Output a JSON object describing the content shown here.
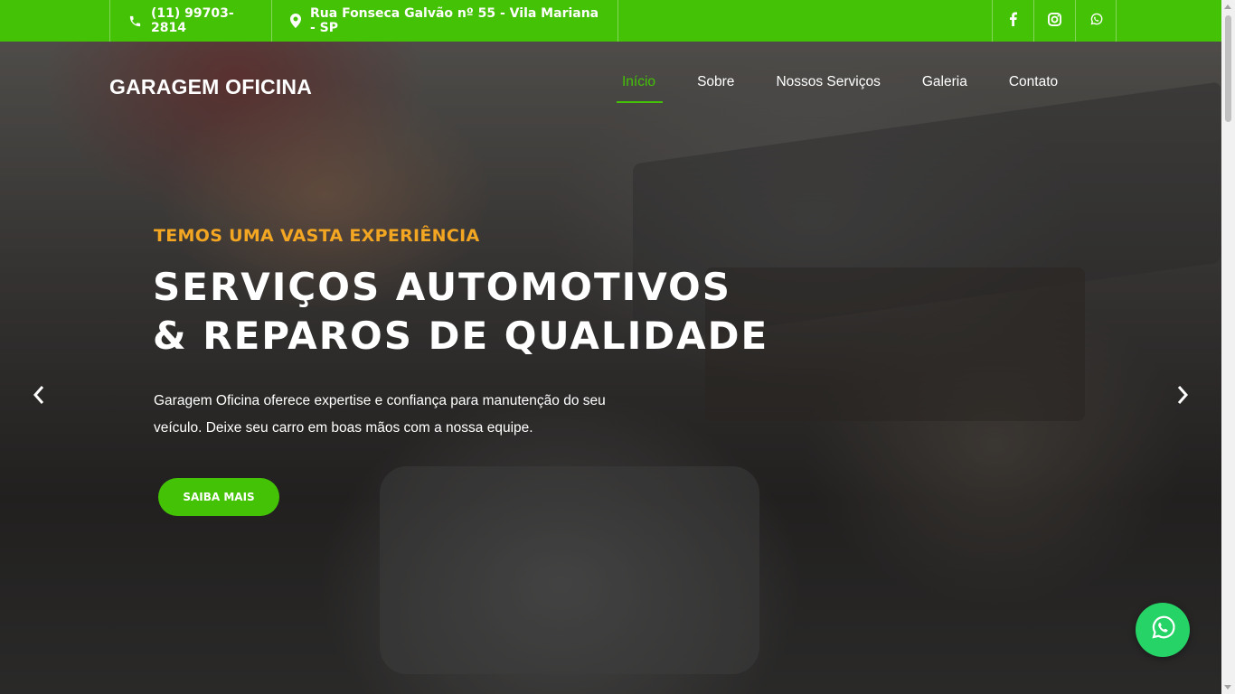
{
  "topbar": {
    "phone": "(11) 99703-2814",
    "address": "Rua Fonseca Galvão nº 55 - Vila Mariana - SP",
    "social": [
      "facebook-icon",
      "instagram-icon",
      "whatsapp-icon"
    ]
  },
  "header": {
    "brand": "GARAGEM OFICINA",
    "nav": [
      "Início",
      "Sobre",
      "Nossos Serviços",
      "Galeria",
      "Contato"
    ],
    "active_nav": "Início"
  },
  "hero": {
    "kicker": "TEMOS UMA VASTA EXPERIÊNCIA",
    "headline_line1": "SERVIÇOS AUTOMOTIVOS",
    "headline_line2": "& REPAROS DE QUALIDADE",
    "description_line1": "Garagem Oficina oferece expertise e confiança para manutenção do seu",
    "description_line2": "veículo. Deixe seu carro em boas mãos com a nossa equipe.",
    "cta_label": "SAIBA MAIS"
  },
  "colors": {
    "brand_green": "#44c205",
    "kicker_orange": "#f3a622",
    "whatsapp_green": "#25d366"
  }
}
